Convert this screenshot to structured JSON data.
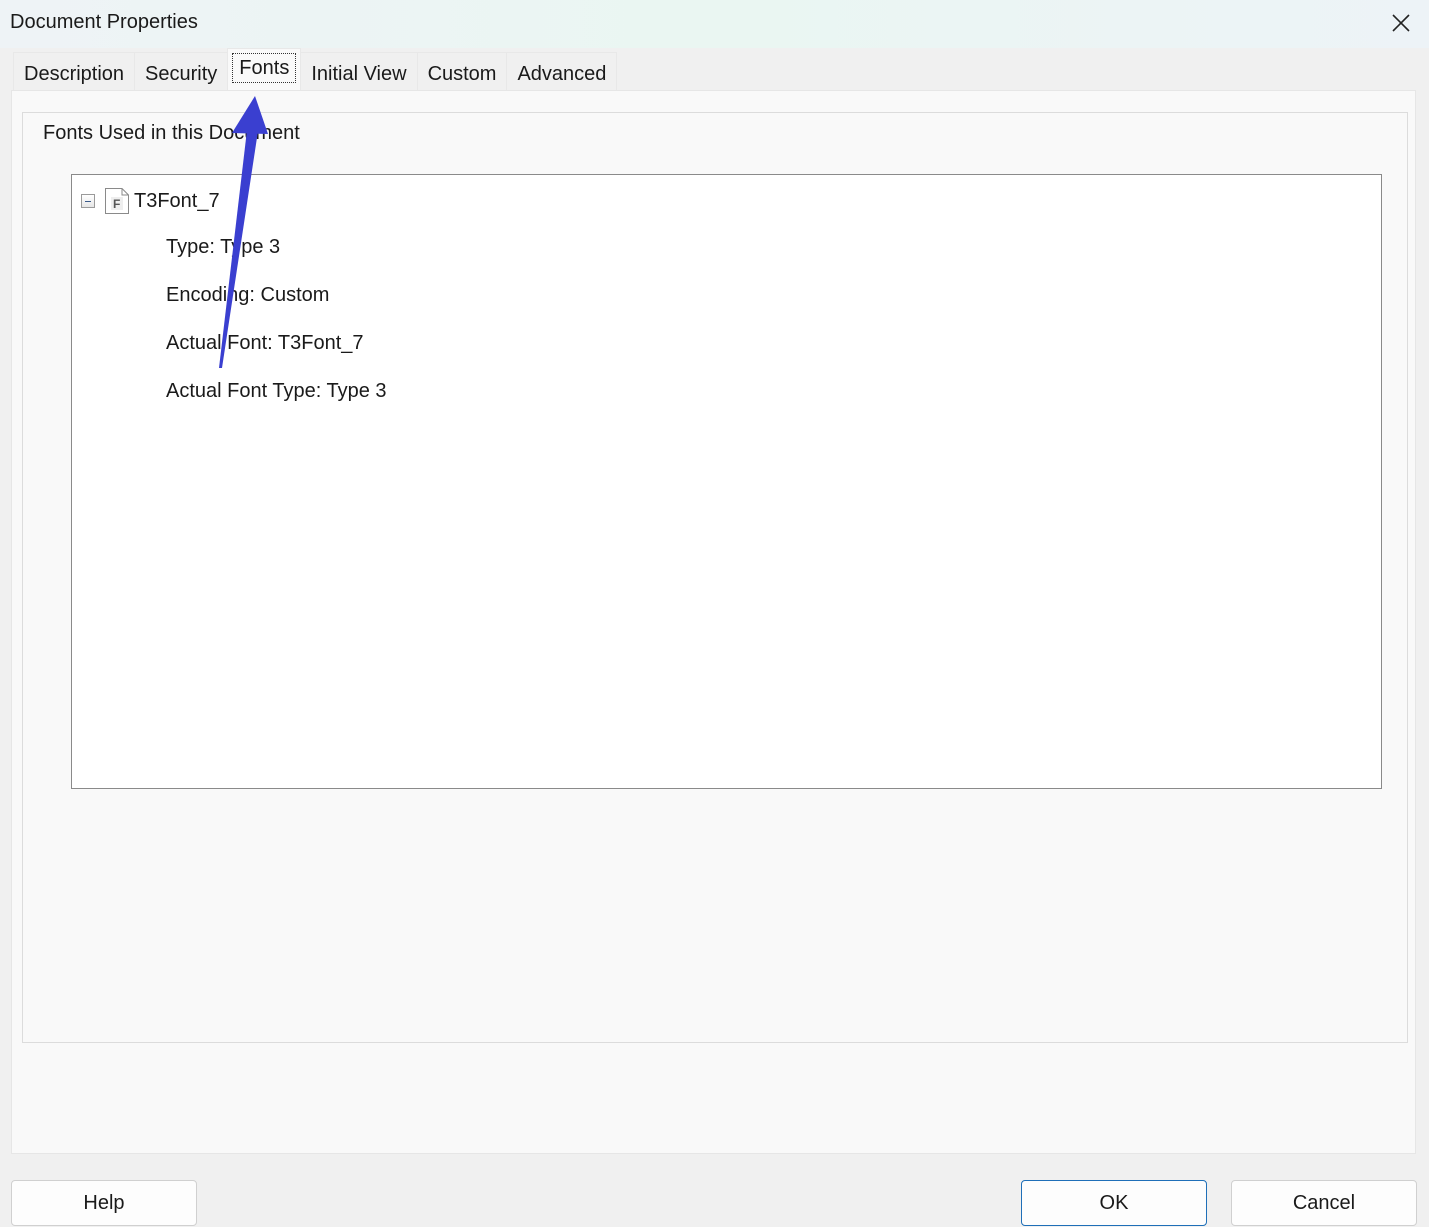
{
  "window": {
    "title": "Document Properties",
    "close_icon": "close-icon"
  },
  "tabs": [
    {
      "label": "Description",
      "active": false
    },
    {
      "label": "Security",
      "active": false
    },
    {
      "label": "Fonts",
      "active": true
    },
    {
      "label": "Initial View",
      "active": false
    },
    {
      "label": "Custom",
      "active": false
    },
    {
      "label": "Advanced",
      "active": false
    }
  ],
  "fonts_panel": {
    "group_label": "Fonts Used in this Document",
    "fonts": [
      {
        "name": "T3Font_7",
        "expanded": true,
        "icon": "font-file-icon",
        "properties": [
          "Type: Type 3",
          "Encoding: Custom",
          "Actual Font: T3Font_7",
          "Actual Font Type: Type 3"
        ]
      }
    ]
  },
  "buttons": {
    "help": "Help",
    "ok": "OK",
    "cancel": "Cancel"
  },
  "annotation": {
    "type": "arrow",
    "color": "#3a3fd0",
    "points_to": "Fonts tab"
  }
}
